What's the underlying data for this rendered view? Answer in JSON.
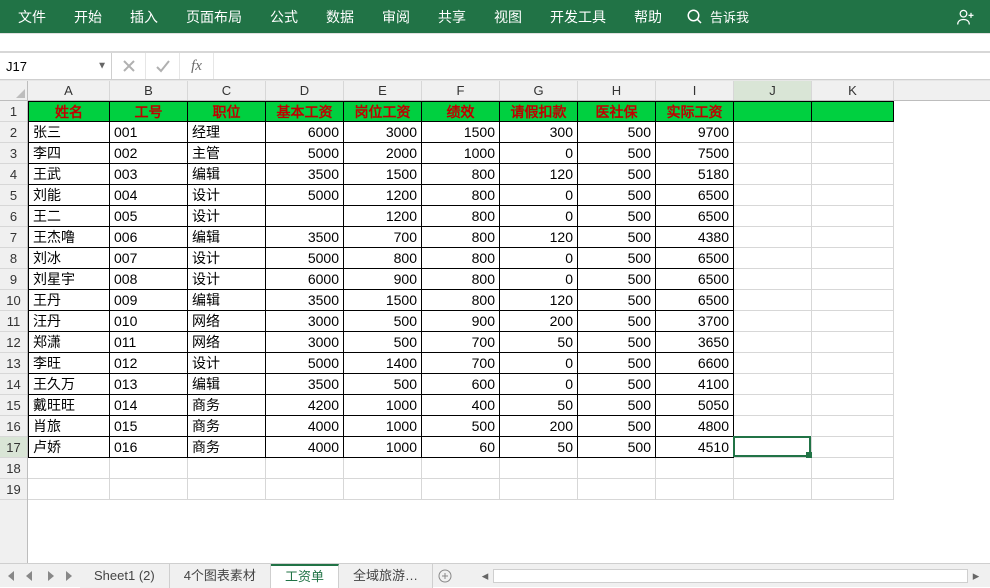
{
  "ribbon": {
    "items": [
      "文件",
      "开始",
      "插入",
      "页面布局",
      "公式",
      "数据",
      "审阅",
      "共享",
      "视图",
      "开发工具",
      "帮助"
    ],
    "tell_me": "告诉我"
  },
  "formula_bar": {
    "name_box": "J17",
    "formula": ""
  },
  "columns": {
    "letters": [
      "A",
      "B",
      "C",
      "D",
      "E",
      "F",
      "G",
      "H",
      "I",
      "J",
      "K"
    ],
    "widths": [
      82,
      78,
      78,
      78,
      78,
      78,
      78,
      78,
      78,
      78,
      82
    ]
  },
  "rows": {
    "count": 19,
    "active_row": 17,
    "active_col_index": 9
  },
  "chart_data": {
    "type": "table",
    "headers": [
      "姓名",
      "工号",
      "职位",
      "基本工资",
      "岗位工资",
      "绩效",
      "请假扣款",
      "医社保",
      "实际工资"
    ],
    "rows": [
      {
        "name": "张三",
        "id": "001",
        "pos": "经理",
        "base": 6000,
        "post": 3000,
        "perf": 1500,
        "deduct": 300,
        "ins": 500,
        "net": 9700
      },
      {
        "name": "李四",
        "id": "002",
        "pos": "主管",
        "base": 5000,
        "post": 2000,
        "perf": 1000,
        "deduct": 0,
        "ins": 500,
        "net": 7500
      },
      {
        "name": "王武",
        "id": "003",
        "pos": "编辑",
        "base": 3500,
        "post": 1500,
        "perf": 800,
        "deduct": 120,
        "ins": 500,
        "net": 5180
      },
      {
        "name": "刘能",
        "id": "004",
        "pos": "设计",
        "base": 5000,
        "post": 1200,
        "perf": 800,
        "deduct": 0,
        "ins": 500,
        "net": 6500
      },
      {
        "name": "王二",
        "id": "005",
        "pos": "设计",
        "base": "",
        "post": 1200,
        "perf": 800,
        "deduct": 0,
        "ins": 500,
        "net": 6500
      },
      {
        "name": "王杰噜",
        "id": "006",
        "pos": "编辑",
        "base": 3500,
        "post": 700,
        "perf": 800,
        "deduct": 120,
        "ins": 500,
        "net": 4380
      },
      {
        "name": "刘冰",
        "id": "007",
        "pos": "设计",
        "base": 5000,
        "post": 800,
        "perf": 800,
        "deduct": 0,
        "ins": 500,
        "net": 6500
      },
      {
        "name": "刘星宇",
        "id": "008",
        "pos": "设计",
        "base": 6000,
        "post": 900,
        "perf": 800,
        "deduct": 0,
        "ins": 500,
        "net": 6500
      },
      {
        "name": "王丹",
        "id": "009",
        "pos": "编辑",
        "base": 3500,
        "post": 1500,
        "perf": 800,
        "deduct": 120,
        "ins": 500,
        "net": 6500
      },
      {
        "name": "汪丹",
        "id": "010",
        "pos": "网络",
        "base": 3000,
        "post": 500,
        "perf": 900,
        "deduct": 200,
        "ins": 500,
        "net": 3700
      },
      {
        "name": "郑潇",
        "id": "011",
        "pos": "网络",
        "base": 3000,
        "post": 500,
        "perf": 700,
        "deduct": 50,
        "ins": 500,
        "net": 3650
      },
      {
        "name": "李旺",
        "id": "012",
        "pos": "设计",
        "base": 5000,
        "post": 1400,
        "perf": 700,
        "deduct": 0,
        "ins": 500,
        "net": 6600
      },
      {
        "name": "王久万",
        "id": "013",
        "pos": "编辑",
        "base": 3500,
        "post": 500,
        "perf": 600,
        "deduct": 0,
        "ins": 500,
        "net": 4100
      },
      {
        "name": "戴旺旺",
        "id": "014",
        "pos": "商务",
        "base": 4200,
        "post": 1000,
        "perf": 400,
        "deduct": 50,
        "ins": 500,
        "net": 5050
      },
      {
        "name": "肖旅",
        "id": "015",
        "pos": "商务",
        "base": 4000,
        "post": 1000,
        "perf": 500,
        "deduct": 200,
        "ins": 500,
        "net": 4800
      },
      {
        "name": "卢娇",
        "id": "016",
        "pos": "商务",
        "base": 4000,
        "post": 1000,
        "perf": 60,
        "deduct": 50,
        "ins": 500,
        "net": 4510
      }
    ]
  },
  "tabs": {
    "items": [
      "Sheet1 (2)",
      "4个图表素材",
      "工资单",
      "全域旅游…"
    ],
    "active_index": 2
  }
}
